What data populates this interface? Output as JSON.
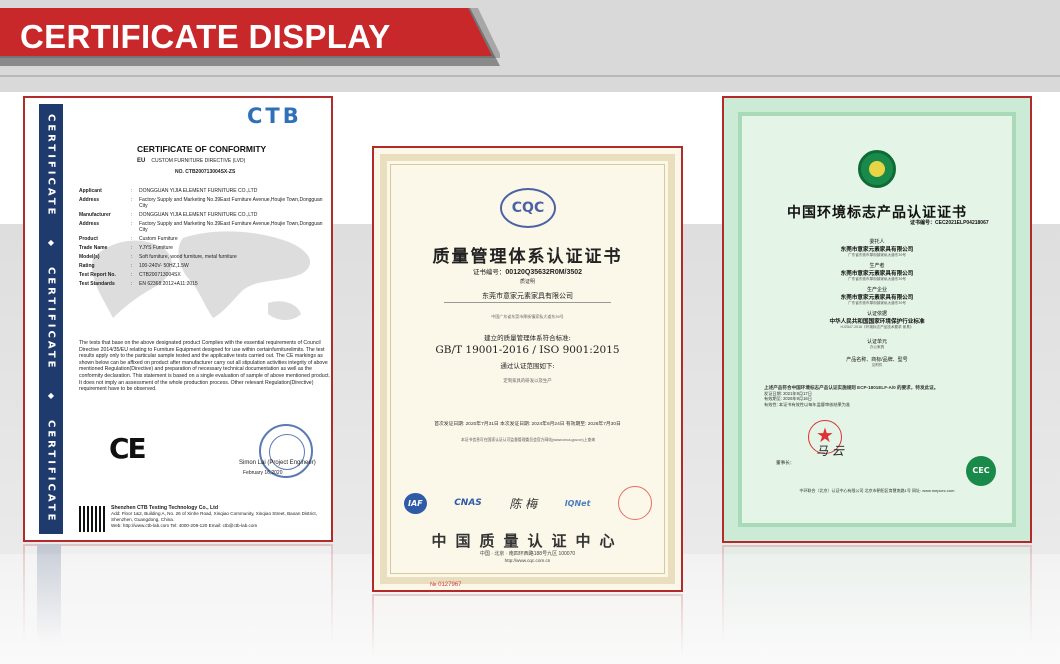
{
  "banner": {
    "title": "CERTIFICATE DISPLAY"
  },
  "colors": {
    "banner_red": "#c8282a",
    "border_red": "#b32a2a",
    "ctb_navy": "#1f3b6e",
    "cqc_blue": "#4a63a5",
    "cec_green": "#1a8a4a"
  },
  "cert_ctb": {
    "side_words": [
      "CERTIFICATE",
      "CERTIFICATE",
      "CERTIFICATE"
    ],
    "diamond": "◆",
    "logo": "CTB",
    "title": "CERTIFICATE OF CONFORMITY",
    "eu_label": "EU",
    "directive": "CUSTOM FURNITURE DIRECTIVE (LVD)",
    "number": "NO. CTB200713004SX-ZS",
    "rows": [
      {
        "k": "Applicant",
        "v": "DONGGUAN YIJIA ELEMENT FURNITURE CO.,LTD"
      },
      {
        "k": "Address",
        "v": "Factory Supply and Marketing No.39East Furniture Avenue,Houjie Town,Dongguan City"
      },
      {
        "k": "Manufacturer",
        "v": "DONGGUAN YIJIA ELEMENT FURNITURE CO.,LTD"
      },
      {
        "k": "Address",
        "v": "Factory Supply and Marketing No.39East Furniture Avenue,Houjie Town,Dongguan City"
      },
      {
        "k": "Product",
        "v": "Custom Furniture"
      },
      {
        "k": "Trade Name",
        "v": "YJYS Furniture"
      },
      {
        "k": "Model(s)",
        "v": "Soft furniture, wood furniture, metal furniture"
      },
      {
        "k": "Rating",
        "v": "100-240V- 50HZ,1.5W"
      },
      {
        "k": "Test Report No.",
        "v": "CTB200713004SX"
      },
      {
        "k": "Test Standards",
        "v": "EN 62368:2012+A11:2015"
      }
    ],
    "paragraph": "The tests that base on the above designated product Complies with the essential requirements of Council Directive 2014/35/EU relating to Furniture Equipment designed for use within certainfurniturelimits. The test results apply only to the particular sample tested and the applicative tests carried out. The CE markings as shown below can be affixed on product after manufacturer carry out all stipulation activities integrity of above mentioned Regulation(Directive) and preparation of necessary technical documentation as well as the conformity declaration. This statement is based on a single evaluation of sample of above mentioned product. It does not imply an assessment of the whole production process. Other relevant Regulation(Directive) requirement have to be observed.",
    "ce_mark": "CE",
    "signer": "Simon Lai (Project Engineer)",
    "sign_date": "February 16,2020",
    "footer_company": "Shenzhen CTB Testing Technology Co., Ltd",
    "footer_address": "Add: Floor 1&2, Building A, No. 26 of Xinhe Road, Xinqiao Community, Xinqiao Street, Baoan District, Shenzhen, Guangdong, China.",
    "footer_contact": "Web: http://www.ctb-lab.com    Tel: 4000-208-120    Email: ctb@ctb-lab.com"
  },
  "cert_cqc": {
    "logo": "CQC",
    "title": "质量管理体系认证证书",
    "number_label": "证书编号：",
    "number": "00120Q35632R0M/3502",
    "sub": "质证明",
    "company": "东莞市意家元素家具有限公司",
    "address_small": "中国广东省东莞市厚街镇家私大道东39号",
    "std_lead": "建立的质量管理体系符合标准:",
    "standard": "GB/T 19001-2016 / ISO 9001:2015",
    "scope_lead": "通过认证范围如下:",
    "scope": "定制家具的研发以及生产",
    "dates": "首次发证日期: 2020年7月31日   本次发证日期: 2024年6月24日   有效期至: 2026年7月30日",
    "note": "本证书信息可在国家认证认可监督管理委员会官方网站(www.cnca.gov.cn)上查询",
    "badges": [
      "IAF",
      "CNAS",
      "IQNet"
    ],
    "signature": "陈 梅",
    "org": "中国质量认证中心",
    "addr": "中国 · 北京 · 南四环西路188号九区   100070",
    "web": "http://www.cqc.com.cn",
    "serial": "№ 0127967"
  },
  "cert_cec": {
    "title": "中国环境标志产品认证证书",
    "number": "证书编号：CEC2021ELP04218067",
    "blocks": [
      {
        "k": "委托人",
        "v": "东莞市意家元素家具有限公司",
        "f": "广东省东莞市厚街镇家私大道东39号"
      },
      {
        "k": "生产者",
        "v": "东莞市意家元素家具有限公司",
        "f": "广东省东莞市厚街镇家私大道东39号"
      },
      {
        "k": "生产企业",
        "v": "东莞市意家元素家具有限公司",
        "f": "广东省东莞市厚街镇家私大道东39号"
      },
      {
        "k": "认证依据",
        "v": "中华人民共和国国家环境保护行业标准",
        "f": "HJ2547-2016《环境标志产品技术要求 家具》"
      },
      {
        "k": "认证单元",
        "v": "",
        "f": "办公家具"
      },
      {
        "k": "产品名称、商标/品牌、型号",
        "v": "",
        "f": "见附件"
      }
    ],
    "text_main": "上述产品符合中国环境标志产品认证实施规则 ECP-1801ELF-A/0 的要求，特发此证。",
    "text_lines": [
      "发证日期: 2021年9月17日",
      "有效期至: 2026年9月16日",
      "有效性: 本证书有效性以每年监督审核结果为准"
    ],
    "signer": "董事长：",
    "cec_logo": "CEC",
    "foot": "中环联合（北京）认证中心有限公司  北京市朝阳区育慧南路1号  网址: www.mepcec.com",
    "seal_star": "★",
    "signature": "马 云"
  }
}
